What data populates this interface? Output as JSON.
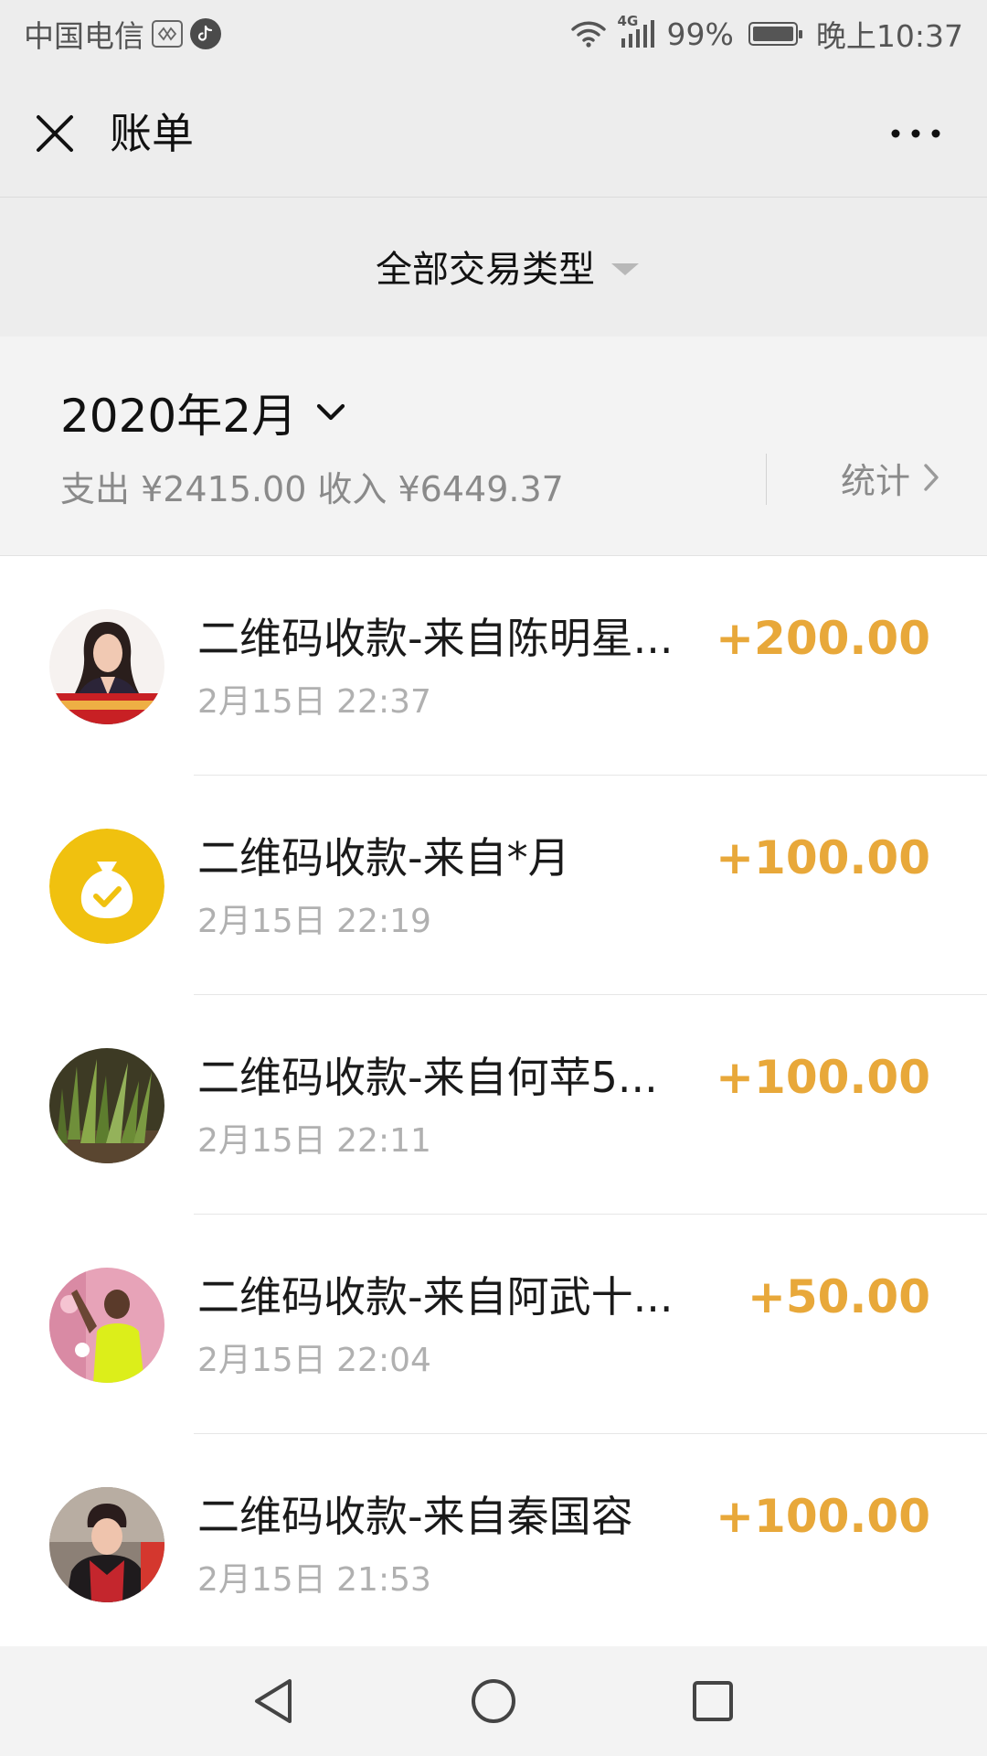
{
  "status_bar": {
    "carrier": "中国电信",
    "network": "4G",
    "battery": "99%",
    "time": "晚上10:37",
    "icons": [
      "sim-card-icon",
      "tiktok-icon",
      "wifi-icon",
      "signal-icon",
      "battery-icon"
    ]
  },
  "header": {
    "title": "账单",
    "close_icon": "close-icon",
    "more_icon": "more-dots-icon"
  },
  "filter": {
    "label": "全部交易类型"
  },
  "month": {
    "label": "2020年2月",
    "expense": "支出 ¥2415.00",
    "income": "收入 ¥6449.37",
    "stats_label": "统计"
  },
  "transactions": [
    {
      "title": "二维码收款-来自陈明星...",
      "time": "2月15日 22:37",
      "amount": "+200.00",
      "avatar": "photo-woman-portrait"
    },
    {
      "title": "二维码收款-来自*月",
      "time": "2月15日 22:19",
      "amount": "+100.00",
      "avatar": "money-bag-icon"
    },
    {
      "title": "二维码收款-来自何苹5...",
      "time": "2月15日 22:11",
      "amount": "+100.00",
      "avatar": "photo-plant"
    },
    {
      "title": "二维码收款-来自阿武十...",
      "time": "2月15日 22:04",
      "amount": "+50.00",
      "avatar": "photo-person-yellow-shirt"
    },
    {
      "title": "二维码收款-来自秦国容",
      "time": "2月15日 21:53",
      "amount": "+100.00",
      "avatar": "photo-woman-red-coat"
    }
  ],
  "colors": {
    "amount": "#e8a83a",
    "money_bag_bg": "#f0c10f",
    "background": "#ededed",
    "list_bg": "#ffffff"
  },
  "nav": {
    "icons": [
      "back-icon",
      "home-icon",
      "recents-icon"
    ]
  }
}
